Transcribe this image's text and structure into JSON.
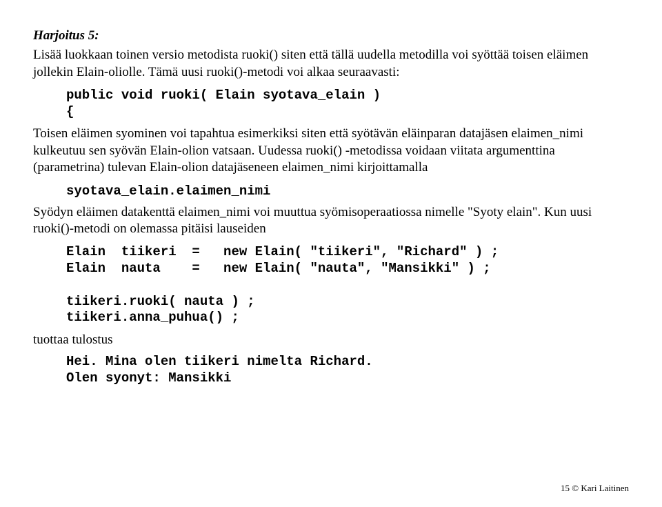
{
  "heading": "Harjoitus 5:",
  "p1": "Lisää luokkaan toinen versio metodista ruoki() siten että tällä uudella metodilla voi syöttää toisen eläimen jollekin Elain-oliolle. Tämä uusi ruoki()-metodi voi alkaa seuraavasti:",
  "code1": "public void ruoki( Elain syotava_elain )\n{",
  "p2": "Toisen eläimen syominen voi tapahtua esimerkiksi siten että syötävän eläinparan datajäsen elaimen_nimi kulkeutuu sen syövän Elain-olion vatsaan. Uudessa ruoki() -metodissa voidaan viitata argumenttina (parametrina) tulevan Elain-olion datajäseneen elaimen_nimi kirjoittamalla",
  "code2": "syotava_elain.elaimen_nimi",
  "p3": "Syödyn eläimen datakenttä elaimen_nimi voi muuttua syömisoperaatiossa nimelle \"Syoty elain\". Kun uusi ruoki()-metodi on olemassa pitäisi lauseiden",
  "code3": "Elain  tiikeri  =   new Elain( \"tiikeri\", \"Richard\" ) ;\nElain  nauta    =   new Elain( \"nauta\", \"Mansikki\" ) ;\n\ntiikeri.ruoki( nauta ) ;\ntiikeri.anna_puhua() ;",
  "p4": "tuottaa tulostus",
  "code4": "Hei. Mina olen tiikeri nimelta Richard.\nOlen syonyt: Mansikki",
  "footer": "15 © Kari Laitinen"
}
